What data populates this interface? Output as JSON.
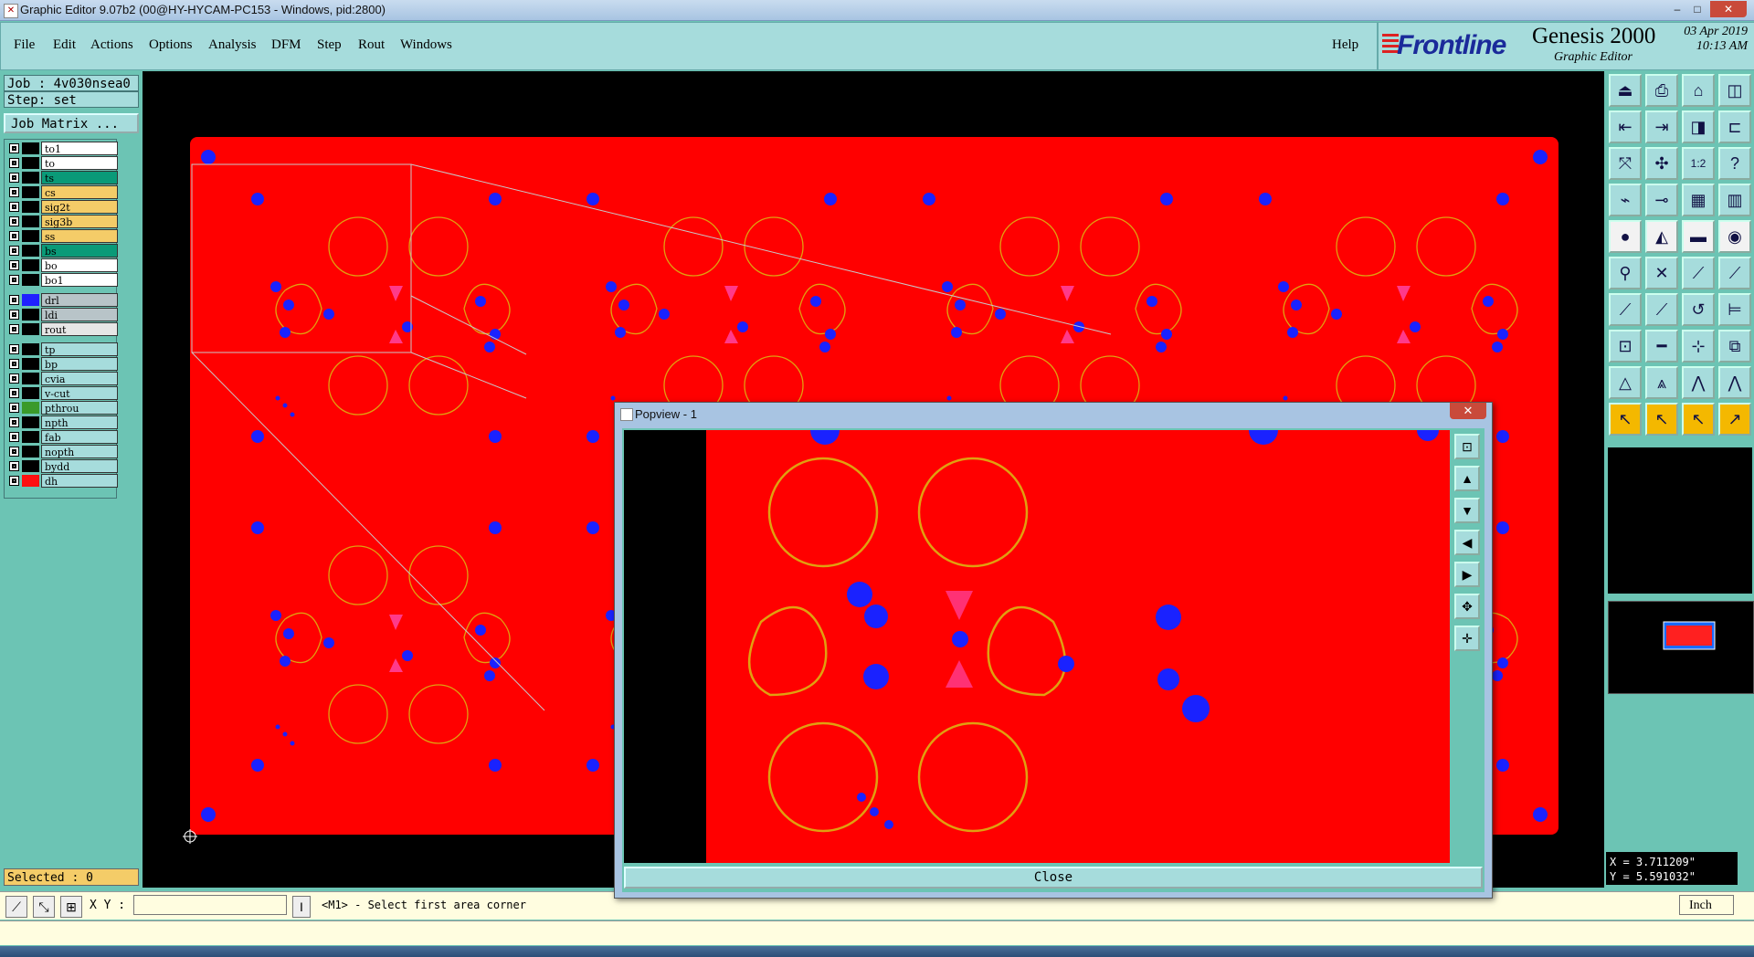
{
  "window": {
    "title": "Graphic Editor 9.07b2 (00@HY-HYCAM-PC153 - Windows, pid:2800)",
    "min": "–",
    "max": "□",
    "close": "✕"
  },
  "menu": {
    "items": [
      "File",
      "Edit",
      "Actions",
      "Options",
      "Analysis",
      "DFM",
      "Step",
      "Rout",
      "Windows"
    ],
    "help": "Help"
  },
  "logo": {
    "brand": "Frontline",
    "product": "Genesis 2000",
    "subtitle": "Graphic Editor",
    "date": "03 Apr 2019",
    "time": "10:13 AM"
  },
  "job": {
    "job_line": "Job : 4v030nsea0",
    "step_line": "Step: set",
    "matrix_button": "Job Matrix ..."
  },
  "layers": [
    {
      "name": "to1",
      "bg": "#ffffff",
      "swatch": "#000000"
    },
    {
      "name": "to",
      "bg": "#ffffff",
      "swatch": "#000000"
    },
    {
      "name": "ts",
      "bg": "#0a9a78",
      "swatch": "#000000"
    },
    {
      "name": "cs",
      "bg": "#f4cc68",
      "swatch": "#000000"
    },
    {
      "name": "sig2t",
      "bg": "#f4cc68",
      "swatch": "#000000"
    },
    {
      "name": "sig3b",
      "bg": "#f4cc68",
      "swatch": "#000000"
    },
    {
      "name": "ss",
      "bg": "#f4cc68",
      "swatch": "#000000"
    },
    {
      "name": "bs",
      "bg": "#0a9a78",
      "swatch": "#000000"
    },
    {
      "name": "bo",
      "bg": "#ffffff",
      "swatch": "#000000"
    },
    {
      "name": "bo1",
      "bg": "#ffffff",
      "swatch": "#000000"
    },
    {
      "name": "drl",
      "bg": "#b8c4c8",
      "swatch": "#2020ff"
    },
    {
      "name": "ldi",
      "bg": "#b8c4c8",
      "swatch": "#000000"
    },
    {
      "name": "rout",
      "bg": "#e6e6e6",
      "swatch": "#000000"
    },
    {
      "name": "tp",
      "bg": "#a6dcdc",
      "swatch": "#000000"
    },
    {
      "name": "bp",
      "bg": "#a6dcdc",
      "swatch": "#000000"
    },
    {
      "name": "cvia",
      "bg": "#a6dcdc",
      "swatch": "#000000"
    },
    {
      "name": "v-cut",
      "bg": "#a6dcdc",
      "swatch": "#000000"
    },
    {
      "name": "pthrou",
      "bg": "#a6dcdc",
      "swatch": "#3a9a2a"
    },
    {
      "name": "npth",
      "bg": "#a6dcdc",
      "swatch": "#000000"
    },
    {
      "name": "fab",
      "bg": "#a6dcdc",
      "swatch": "#000000"
    },
    {
      "name": "nopth",
      "bg": "#a6dcdc",
      "swatch": "#000000"
    },
    {
      "name": "bydd",
      "bg": "#a6dcdc",
      "swatch": "#000000"
    },
    {
      "name": "dh",
      "bg": "#a6dcdc",
      "swatch": "#ff1010"
    }
  ],
  "selected": "Selected : 0",
  "coords": {
    "x": "X = 3.711209\"",
    "y": "Y = 5.591032\""
  },
  "bottom": {
    "xy_label": "X Y :",
    "xy_value": "",
    "prompt": "<M1> - Select first area corner",
    "unit": "Inch"
  },
  "popup": {
    "title": "Popview - 1",
    "close_button": "Close",
    "close_x": "✕"
  },
  "colors": {
    "board": "#ff0000",
    "pad": "#1a22ff",
    "ring": "#e0a010",
    "silk": "#ff3a8a",
    "frame": "#c8c8c8"
  }
}
